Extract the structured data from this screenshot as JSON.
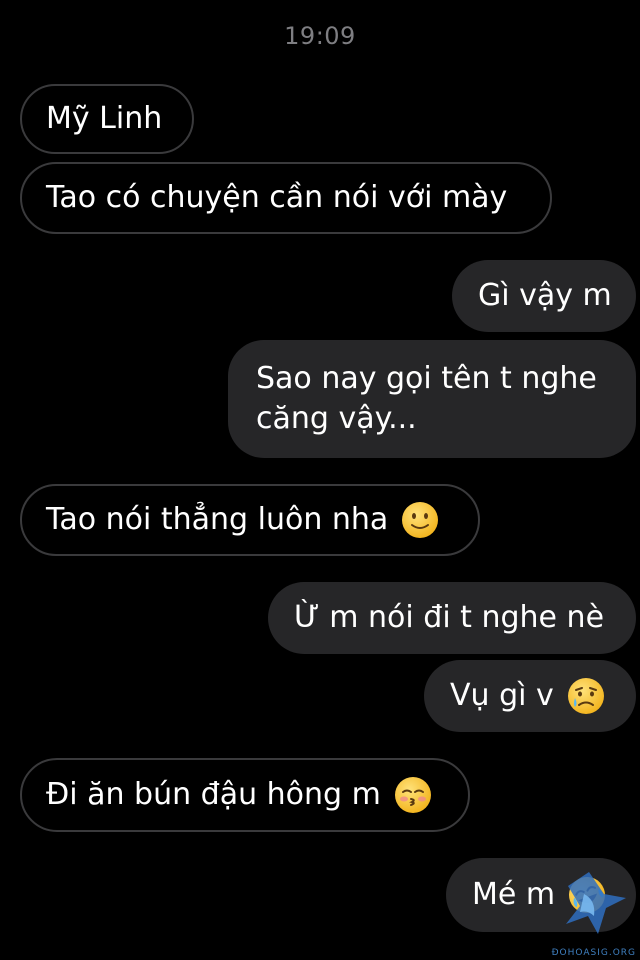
{
  "header": {
    "time": "19:09"
  },
  "messages": [
    {
      "side": "in",
      "text": "Mỹ Linh"
    },
    {
      "side": "in",
      "text": "Tao có chuyện cần nói với mày"
    },
    {
      "side": "out",
      "text": "Gì vậy m"
    },
    {
      "side": "out",
      "text": "Sao nay gọi tên t nghe căng vậy..."
    },
    {
      "side": "in",
      "text": "Tao nói thẳng luôn nha",
      "emoji": "slightly-smiling-face-icon"
    },
    {
      "side": "out",
      "text": "Ừ m nói đi t nghe nè"
    },
    {
      "side": "out",
      "text": "Vụ gì v",
      "emoji": "sad-but-relieved-face-icon"
    },
    {
      "side": "in",
      "text": "Đi ăn bún đậu hông m",
      "emoji": "kissing-face-closed-eyes-icon"
    },
    {
      "side": "out",
      "text": "Mé m",
      "emoji": "face-with-tears-of-joy-icon"
    }
  ],
  "watermark": {
    "text": "ĐOHOASIG.ORG",
    "icon": "bird-logo-icon"
  }
}
